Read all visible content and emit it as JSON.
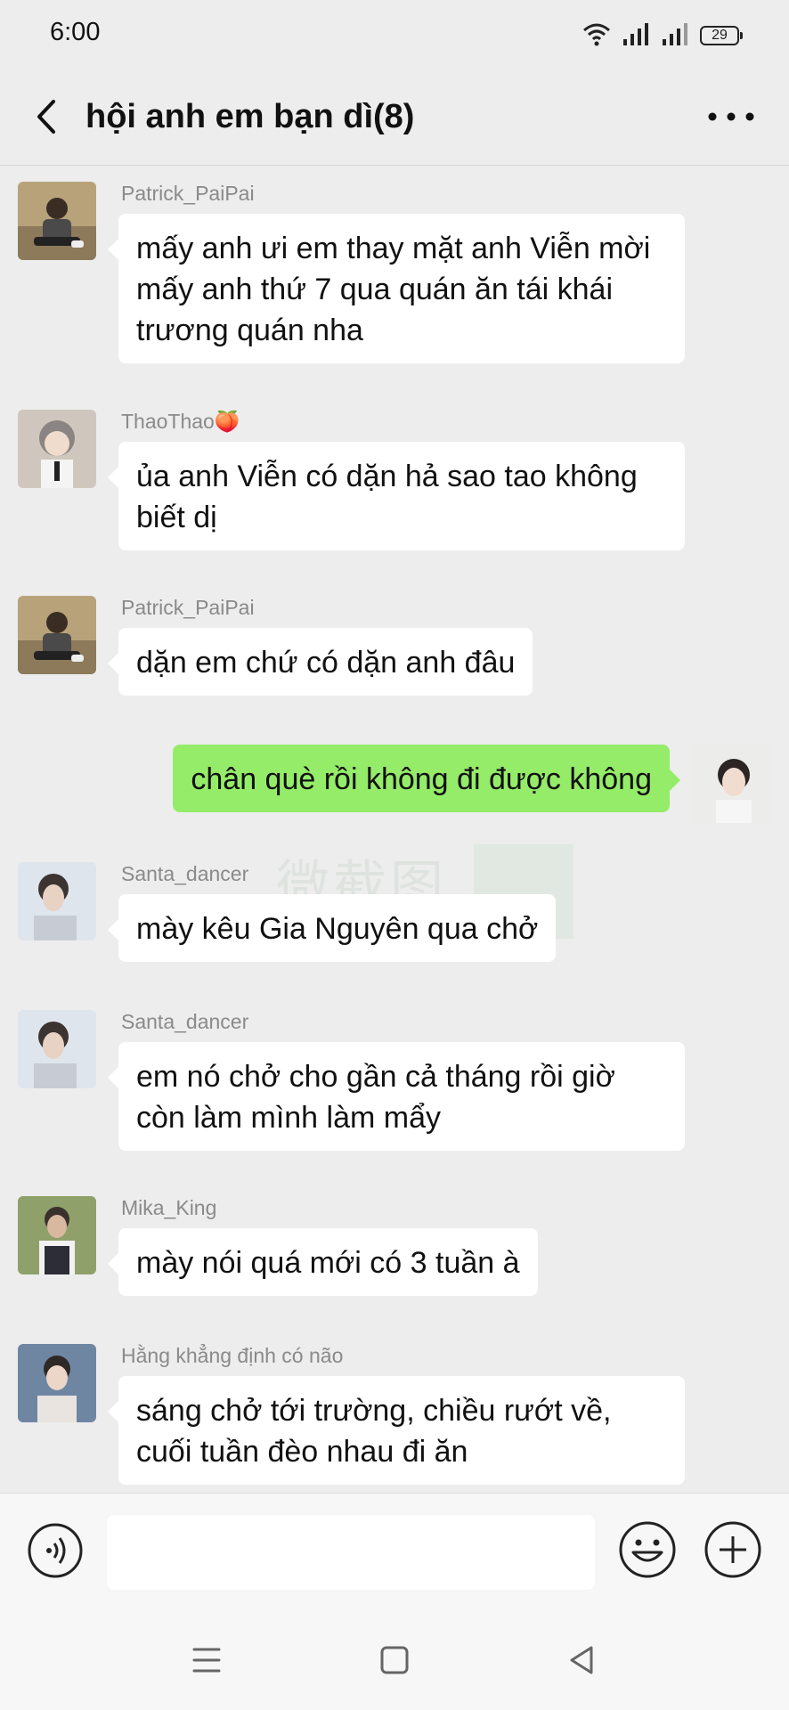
{
  "status_bar": {
    "time": "6:00",
    "battery": "29",
    "icons": [
      "wifi-icon",
      "signal-icon",
      "signal-icon",
      "battery-icon"
    ]
  },
  "header": {
    "title": "hội anh em bạn dì(8)",
    "back_icon": "chevron-left-icon",
    "more_icon": "more-dots-icon"
  },
  "messages": [
    {
      "direction": "in",
      "sender": "Patrick_PaiPai",
      "text": "mấy anh ưi em thay mặt anh Viễn mời mấy anh thứ 7 qua quán ăn tái khái trương quán nha",
      "avatar_color": "#9a8a6a"
    },
    {
      "direction": "in",
      "sender": "ThaoThao🍑",
      "text": "ủa anh Viễn có dặn hả sao tao không biết dị",
      "avatar_color": "#b9b0a6"
    },
    {
      "direction": "in",
      "sender": "Patrick_PaiPai",
      "text": "dặn em chứ có dặn anh đâu",
      "avatar_color": "#9a8a6a"
    },
    {
      "direction": "out",
      "sender": "",
      "text": "chân què rồi không đi được không",
      "avatar_color": "#d8d4d0"
    },
    {
      "direction": "in",
      "sender": "Santa_dancer",
      "text": "mày kêu Gia Nguyên qua chở",
      "avatar_color": "#cfd6e0"
    },
    {
      "direction": "in",
      "sender": "Santa_dancer",
      "text": "em nó chở cho gần cả tháng rồi giờ còn làm mình làm mẩy",
      "avatar_color": "#cfd6e0"
    },
    {
      "direction": "in",
      "sender": "Mika_King",
      "text": "mày nói quá mới có 3 tuần à",
      "avatar_color": "#6f7a4e"
    },
    {
      "direction": "in",
      "sender": "Hằng khẳng định có não",
      "text": "sáng chở tới trường, chiều rướt về, cuối tuần đèo nhau đi ăn",
      "avatar_color": "#7a8ca4"
    }
  ],
  "watermark": "微截图",
  "input_bar": {
    "placeholder": "",
    "voice_icon": "voice-icon",
    "emoji_icon": "emoji-icon",
    "plus_icon": "plus-circle-icon"
  },
  "nav_bar": {
    "icons": [
      "menu-icon",
      "home-square-icon",
      "back-triangle-icon"
    ]
  },
  "colors": {
    "background": "#ededed",
    "outgoing_bubble": "#95ec69",
    "incoming_bubble": "#ffffff",
    "sender_name": "#8a8a8a"
  }
}
